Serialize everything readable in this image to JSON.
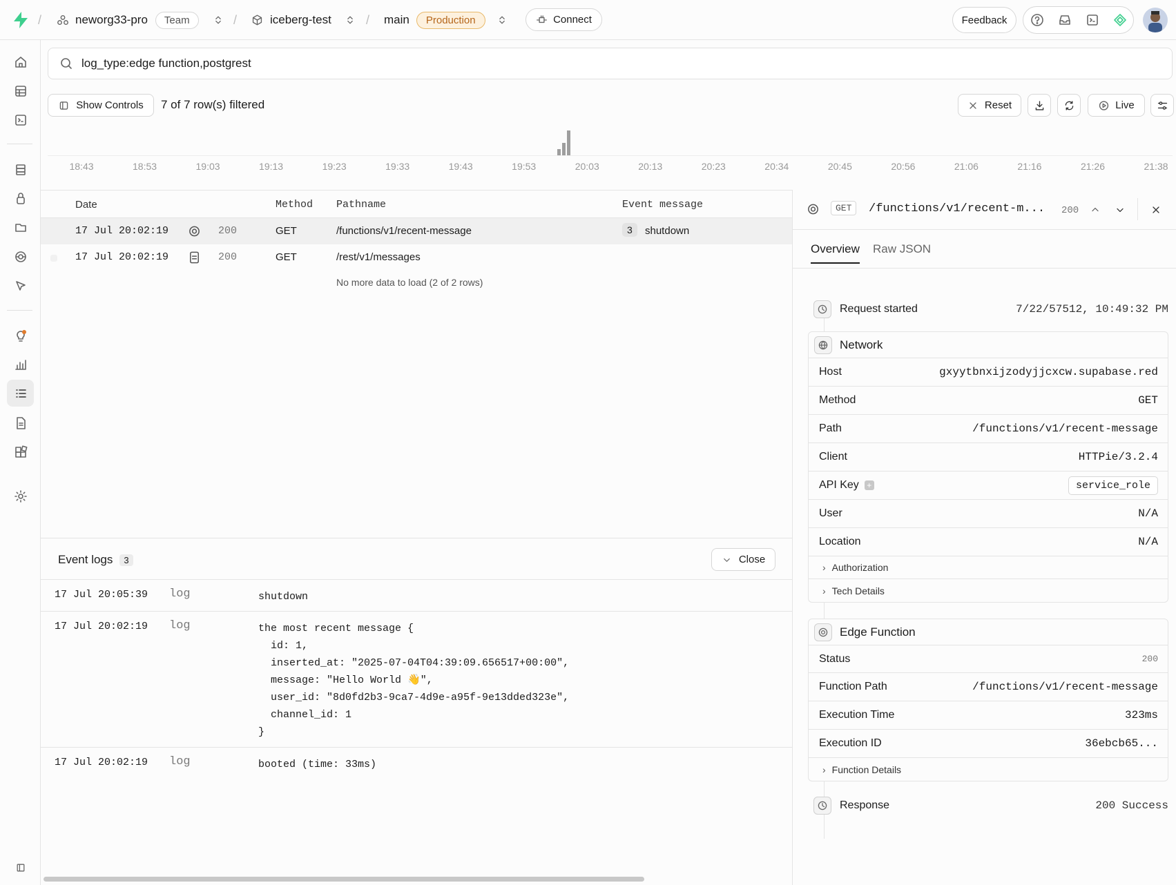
{
  "topbar": {
    "org": "neworg33-pro",
    "org_plan": "Team",
    "project": "iceberg-test",
    "branch": "main",
    "env": "Production",
    "connect": "Connect",
    "feedback": "Feedback"
  },
  "search": {
    "query": "log_type:edge function,postgrest"
  },
  "controls": {
    "show_controls": "Show Controls",
    "filtered": "7 of 7 row(s) filtered",
    "reset": "Reset",
    "live": "Live"
  },
  "histogram": {
    "ticks": [
      "18:43",
      "18:53",
      "19:03",
      "19:13",
      "19:23",
      "19:33",
      "19:43",
      "19:53",
      "20:03",
      "20:13",
      "20:23",
      "20:34",
      "20:45",
      "20:56",
      "21:06",
      "21:16",
      "21:26",
      "21:38"
    ],
    "bars": [
      1,
      2,
      4
    ]
  },
  "table": {
    "headers": {
      "date": "Date",
      "method": "Method",
      "pathname": "Pathname",
      "event": "Event message"
    },
    "rows": [
      {
        "date": "17 Jul 20:02:19",
        "status": "200",
        "method": "GET",
        "path": "/functions/v1/recent-message",
        "count": "3",
        "event": "shutdown"
      },
      {
        "date": "17 Jul 20:02:19",
        "status": "200",
        "method": "GET",
        "path": "/rest/v1/messages",
        "count": "",
        "event": ""
      }
    ],
    "footer": "No more data to load (2 of 2 rows)"
  },
  "events": {
    "title": "Event logs",
    "count": "3",
    "close": "Close",
    "items": [
      {
        "date": "17 Jul 20:05:39",
        "level": "log",
        "message": "shutdown"
      },
      {
        "date": "17 Jul 20:02:19",
        "level": "log",
        "message": "the most recent message {\n  id: 1,\n  inserted_at: \"2025-07-04T04:39:09.656517+00:00\",\n  message: \"Hello World 👋\",\n  user_id: \"8d0fd2b3-9ca7-4d9e-a95f-9e13dded323e\",\n  channel_id: 1\n}"
      },
      {
        "date": "17 Jul 20:02:19",
        "level": "log",
        "message": "booted (time: 33ms)"
      }
    ]
  },
  "detail": {
    "method": "GET",
    "path": "/functions/v1/recent-m...",
    "status": "200",
    "tabs": [
      "Overview",
      "Raw JSON"
    ],
    "request_started_label": "Request started",
    "request_started": "7/22/57512, 10:49:32 PM",
    "network": {
      "title": "Network",
      "host_label": "Host",
      "host": "gxyytbnxijzodyjjcxcw.supabase.red",
      "method_label": "Method",
      "method": "GET",
      "path_label": "Path",
      "path": "/functions/v1/recent-message",
      "client_label": "Client",
      "client": "HTTPie/3.2.4",
      "apikey_label": "API Key",
      "apikey": "service_role",
      "user_label": "User",
      "user": "N/A",
      "location_label": "Location",
      "location": "N/A",
      "auth": "Authorization",
      "tech": "Tech Details"
    },
    "edge": {
      "title": "Edge Function",
      "status_label": "Status",
      "status": "200",
      "fpath_label": "Function Path",
      "fpath": "/functions/v1/recent-message",
      "exec_time_label": "Execution Time",
      "exec_time": "323ms",
      "exec_id_label": "Execution ID",
      "exec_id": "36ebcb65...",
      "details": "Function Details"
    },
    "response_label": "Response",
    "response": "200 Success"
  },
  "colors": {
    "accent": "#3ecf8e",
    "prod_bg": "#fdf1de",
    "prod_text": "#b5661b"
  }
}
